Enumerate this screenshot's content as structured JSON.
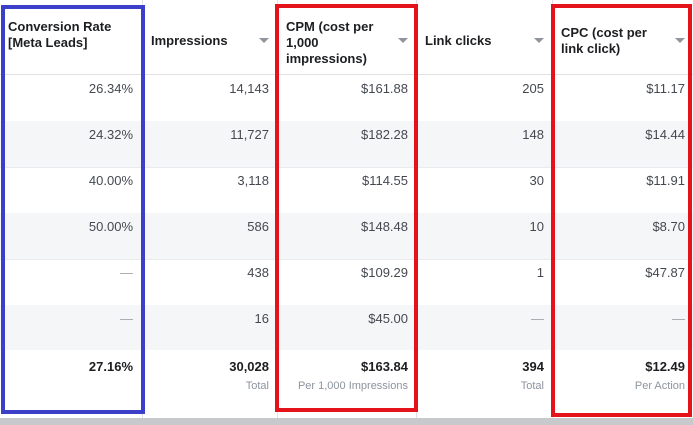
{
  "columns": [
    {
      "header": "Conversion Rate [Meta Leads]",
      "sortable": false,
      "rows": [
        "26.34%",
        "24.32%",
        "40.00%",
        "50.00%",
        "—",
        "—"
      ],
      "total": "27.16%",
      "total_sub": ""
    },
    {
      "header": "Impressions",
      "sortable": true,
      "rows": [
        "14,143",
        "11,727",
        "3,118",
        "586",
        "438",
        "16"
      ],
      "total": "30,028",
      "total_sub": "Total"
    },
    {
      "header": "CPM (cost per 1,000 impressions)",
      "sortable": true,
      "rows": [
        "$161.88",
        "$182.28",
        "$114.55",
        "$148.48",
        "$109.29",
        "$45.00"
      ],
      "total": "$163.84",
      "total_sub": "Per 1,000 Impressions"
    },
    {
      "header": "Link clicks",
      "sortable": true,
      "rows": [
        "205",
        "148",
        "30",
        "10",
        "1",
        "—"
      ],
      "total": "394",
      "total_sub": "Total"
    },
    {
      "header": "CPC (cost per link click)",
      "sortable": true,
      "rows": [
        "$11.17",
        "$14.44",
        "$11.91",
        "$8.70",
        "$47.87",
        "—"
      ],
      "total": "$12.49",
      "total_sub": "Per Action"
    }
  ],
  "highlight_colors": {
    "blue": "#3c3fc7",
    "red": "#e3121b"
  }
}
